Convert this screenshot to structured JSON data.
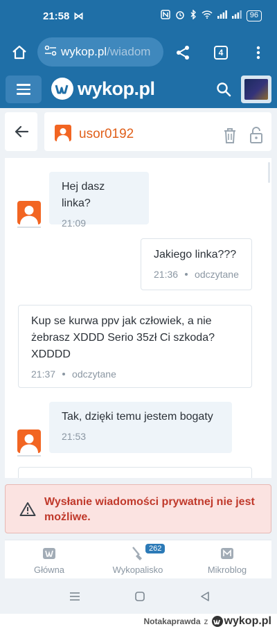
{
  "status_bar": {
    "time": "21:58",
    "notification_glyph": "⋈",
    "battery": "96"
  },
  "browser": {
    "url_host": "wykop.pl",
    "url_path": "/wiadom",
    "tab_count": "4",
    "icons": [
      "home-icon",
      "site-settings-icon",
      "share-icon",
      "more-vertical-icon"
    ]
  },
  "site_header": {
    "logo_text": "wykop.pl",
    "brand_color": "#1f6fa7"
  },
  "conversation": {
    "username": "usor0192",
    "username_color": "#e0601b",
    "messages": [
      {
        "direction": "in",
        "text": "Hej dasz linka?",
        "time": "21:09"
      },
      {
        "direction": "out",
        "text": "Jakiego linka???",
        "time": "21:36",
        "status": "odczytane"
      },
      {
        "direction": "out",
        "text": "Kup se kurwa ppv jak człowiek, a nie żebrasz XDDD Serio 35zł Ci szkoda? XDDDD",
        "time": "21:37",
        "status": "odczytane"
      },
      {
        "direction": "in",
        "text": "Tak, dzięki temu jestem bogaty",
        "time": "21:53"
      }
    ]
  },
  "warning": {
    "text": "Wysłanie wiadomości prywatnej nie jest możliwe.",
    "color": "#c0392b"
  },
  "bottom_nav": {
    "items": [
      {
        "label": "Główna",
        "icon": "home-wykop-icon"
      },
      {
        "label": "Wykopalisko",
        "icon": "shovel-icon",
        "badge": "262"
      },
      {
        "label": "Mikroblog",
        "icon": "mikroblog-icon"
      }
    ]
  },
  "watermark": {
    "source": "Notakaprawda",
    "joiner": "z",
    "brand": "wykop.pl"
  }
}
